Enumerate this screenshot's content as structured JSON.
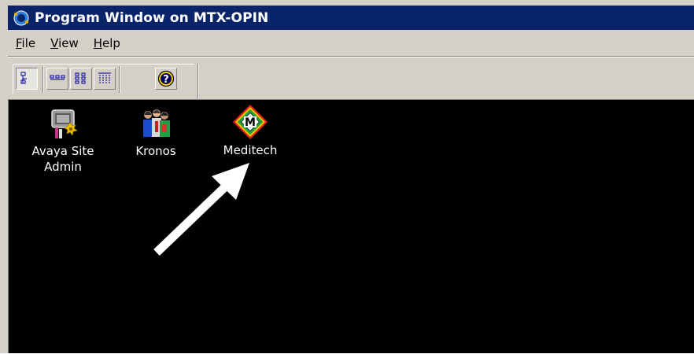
{
  "window": {
    "title": "Program Window on MTX-OPIN",
    "icon": "globe-app-icon"
  },
  "menu": {
    "items": [
      {
        "name": "File",
        "accel": "F",
        "rest": "ile"
      },
      {
        "name": "View",
        "accel": "V",
        "rest": "iew"
      },
      {
        "name": "Help",
        "accel": "H",
        "rest": "elp"
      }
    ]
  },
  "toolbar": {
    "buttons": [
      {
        "icon": "large-icons-view-icon",
        "pressed": true
      },
      {
        "icon": "small-icons-view-icon",
        "pressed": false
      },
      {
        "icon": "list-view-icon",
        "pressed": false
      },
      {
        "icon": "details-view-icon",
        "pressed": false
      },
      {
        "icon": "help-icon",
        "pressed": false
      }
    ]
  },
  "programs": [
    {
      "label": "Avaya Site Admin",
      "icon": "avaya-site-admin-icon"
    },
    {
      "label": "Kronos",
      "icon": "kronos-icon"
    },
    {
      "label": "Meditech",
      "icon": "meditech-icon"
    }
  ],
  "annotation": {
    "type": "arrow",
    "color": "#ffffff",
    "points_to": "Meditech"
  },
  "colors": {
    "titlebar": "#0a246a",
    "chrome": "#d4d0c8",
    "content_bg": "#000000"
  }
}
